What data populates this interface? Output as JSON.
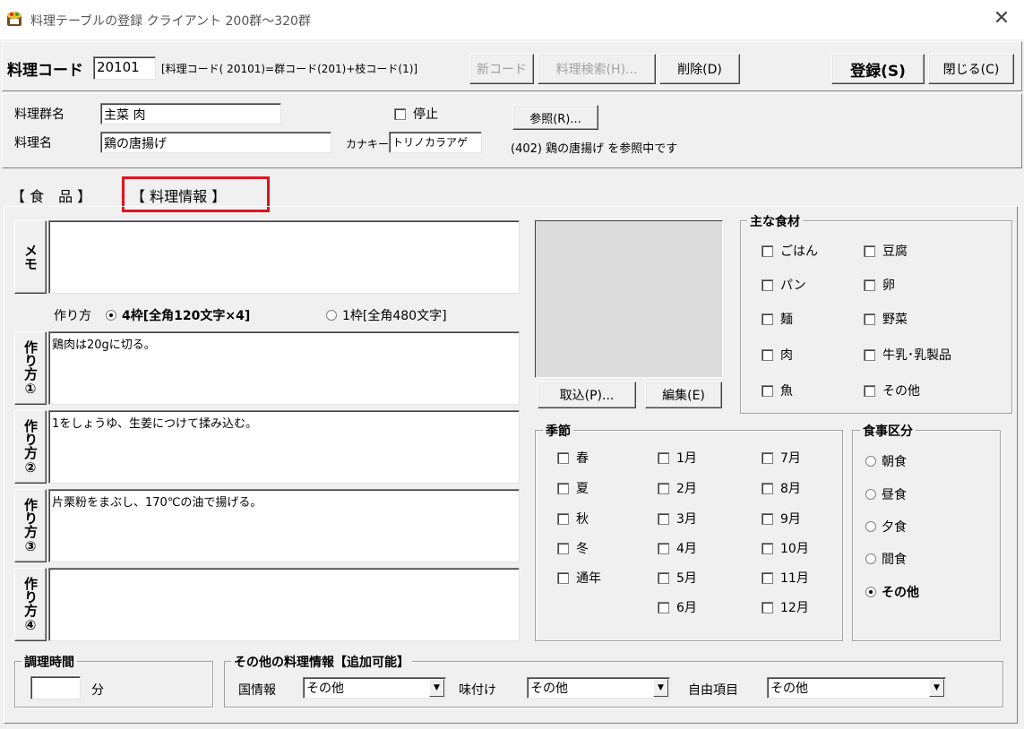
{
  "window": {
    "title": "料理テーブルの登録 クライアント 200群～320群",
    "close_glyph": "✕"
  },
  "header": {
    "code_label": "料理コード",
    "code_value": "20101",
    "code_hint": "[料理コード( 20101)=群コード(201)+枝コード(1)]",
    "btn_new_code": "新コード",
    "btn_search": "料理検索(H)...",
    "btn_delete": "削除(D)",
    "btn_register": "登録(S)",
    "btn_close": "閉じる(C)"
  },
  "info": {
    "group_label": "料理群名",
    "group_value": "主菜 肉",
    "stop_label": "停止",
    "ref_button": "参照(R)...",
    "name_label": "料理名",
    "name_value": "鶏の唐揚げ",
    "kana_label": "カナキー",
    "kana_value": "トリノカラアゲ",
    "ref_status": "(402) 鶏の唐揚げ を参照中です"
  },
  "tabs": {
    "food": "【 食　品 】",
    "dish_info": "【 料理情報 】"
  },
  "memo": {
    "button": "メモ",
    "value": ""
  },
  "method": {
    "label": "作り方",
    "option1": "4枠[全角120文字×4]",
    "option2": "1枠[全角480文字]",
    "steps": [
      {
        "button": "作り方①",
        "text": "鶏肉は20gに切る。"
      },
      {
        "button": "作り方②",
        "text": "1をしょうゆ、生姜につけて揉み込む。"
      },
      {
        "button": "作り方③",
        "text": "片栗粉をまぶし、170℃の油で揚げる。"
      },
      {
        "button": "作り方④",
        "text": ""
      }
    ]
  },
  "image": {
    "btn_import": "取込(P)...",
    "btn_edit": "編集(E)"
  },
  "main_ingredients": {
    "title": "主な食材",
    "items": [
      "ごはん",
      "豆腐",
      "パン",
      "卵",
      "麺",
      "野菜",
      "肉",
      "牛乳･乳製品",
      "魚",
      "その他"
    ]
  },
  "season": {
    "title": "季節",
    "seasons": [
      "春",
      "夏",
      "秋",
      "冬",
      "通年"
    ],
    "months_a": [
      "1月",
      "2月",
      "3月",
      "4月",
      "5月",
      "6月"
    ],
    "months_b": [
      "7月",
      "8月",
      "9月",
      "10月",
      "11月",
      "12月"
    ]
  },
  "meal": {
    "title": "食事区分",
    "options": [
      "朝食",
      "昼食",
      "夕食",
      "間食",
      "その他"
    ],
    "selected": "その他"
  },
  "cook_time": {
    "title": "調理時間",
    "value": "",
    "unit": "分"
  },
  "other_info": {
    "title": "その他の料理情報【追加可能】",
    "country_label": "国情報",
    "country_value": "その他",
    "flavor_label": "味付け",
    "flavor_value": "その他",
    "free_label": "自由項目",
    "free_value": "その他"
  },
  "colors": {
    "highlight": "#e0141e",
    "face": "#f0f0f0"
  }
}
